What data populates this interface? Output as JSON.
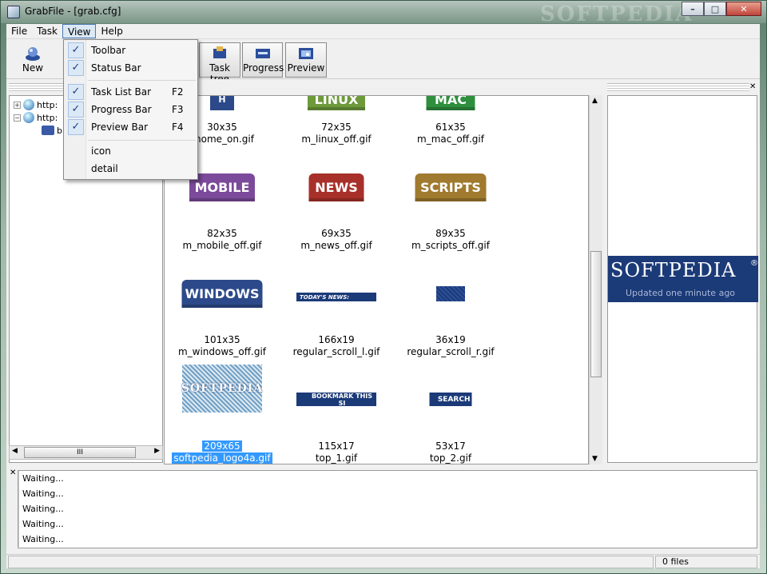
{
  "window": {
    "title": "GrabFile - [grab.cfg]",
    "watermark": "SOFTPEDIA"
  },
  "menubar": {
    "items": [
      "File",
      "Task",
      "View",
      "Help"
    ]
  },
  "toolbar": {
    "new": "New",
    "task_tree": "Task tree",
    "progress": "Progress",
    "preview": "Preview"
  },
  "view_menu": {
    "toolbar": "Toolbar",
    "status_bar": "Status Bar",
    "task_list_bar": "Task List Bar",
    "task_list_bar_sc": "F2",
    "progress_bar": "Progress Bar",
    "progress_bar_sc": "F3",
    "preview_bar": "Preview Bar",
    "preview_bar_sc": "F4",
    "icon": "icon",
    "detail": "detail"
  },
  "tree": {
    "item1": "http:",
    "item2": "http:",
    "item3": "b"
  },
  "grid": [
    {
      "thumb_text": "H",
      "dims": "30x35",
      "name": "_home_on.gif"
    },
    {
      "thumb_text": "LINUX",
      "dims": "72x35",
      "name": "m_linux_off.gif"
    },
    {
      "thumb_text": "MAC",
      "dims": "61x35",
      "name": "m_mac_off.gif"
    },
    {
      "thumb_text": "MOBILE",
      "dims": "82x35",
      "name": "m_mobile_off.gif"
    },
    {
      "thumb_text": "NEWS",
      "dims": "69x35",
      "name": "m_news_off.gif"
    },
    {
      "thumb_text": "SCRIPTS",
      "dims": "89x35",
      "name": "m_scripts_off.gif"
    },
    {
      "thumb_text": "WINDOWS",
      "dims": "101x35",
      "name": "m_windows_off.gif"
    },
    {
      "thumb_text": "TODAY'S NEWS:",
      "dims": "166x19",
      "name": "regular_scroll_l.gif"
    },
    {
      "thumb_text": "",
      "dims": "36x19",
      "name": "regular_scroll_r.gif"
    },
    {
      "thumb_text": "SOFTPEDIA",
      "dims": "209x65",
      "name": "softpedia_logo4a.gif"
    },
    {
      "thumb_text": "BOOKMARK THIS SI",
      "dims": "115x17",
      "name": "top_1.gif"
    },
    {
      "thumb_text": "SEARCH",
      "dims": "53x17",
      "name": "top_2.gif"
    }
  ],
  "preview": {
    "logo": "SOFTPEDIA",
    "logo_reg": "®",
    "tagline": "Updated one minute ago"
  },
  "log": [
    "Waiting...",
    "Waiting...",
    "Waiting...",
    "Waiting...",
    "Waiting..."
  ],
  "status": {
    "files": "0 files"
  },
  "colors": {
    "linux": "#6e9a3c",
    "mac": "#2f8f3e",
    "mobile": "#7b4a9a",
    "news": "#a8302a",
    "scripts": "#a07a2e",
    "windows": "#2c4a8a",
    "navy": "#1b3a78",
    "selection": "#3399ff"
  }
}
